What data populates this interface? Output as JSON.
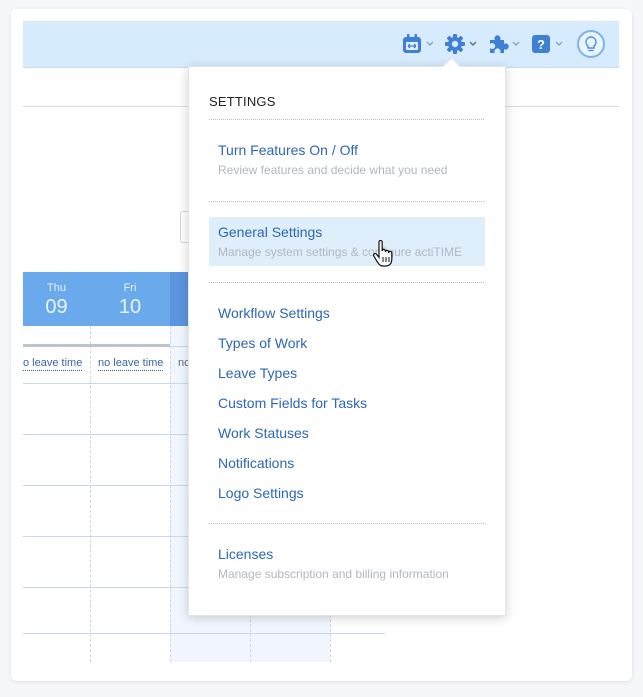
{
  "topbar": {
    "icons": [
      {
        "name": "calendar-icon",
        "has_dropdown": true
      },
      {
        "name": "gear-icon",
        "has_dropdown": true
      },
      {
        "name": "puzzle-icon",
        "has_dropdown": true
      },
      {
        "name": "help-icon",
        "has_dropdown": true
      },
      {
        "name": "lightbulb-icon",
        "has_dropdown": false
      }
    ],
    "help_glyph": "?"
  },
  "calendar": {
    "days": [
      {
        "dow": "Thu",
        "num": "09"
      },
      {
        "dow": "Fri",
        "num": "10"
      }
    ],
    "leave_labels": [
      "o leave time",
      "no leave time",
      "nc"
    ]
  },
  "settings_menu": {
    "title": "SETTINGS",
    "group1": [
      {
        "label": "Turn Features On / Off",
        "sub": "Review features and decide what you need"
      }
    ],
    "group2": [
      {
        "label": "General Settings",
        "sub": "Manage system settings & configure actiTIME",
        "highlighted": true
      }
    ],
    "group3": [
      "Workflow Settings",
      "Types of Work",
      "Leave Types",
      "Custom Fields for Tasks",
      "Work Statuses",
      "Notifications",
      "Logo Settings"
    ],
    "group4": [
      {
        "label": "Licenses",
        "sub": "Manage subscription and billing information"
      }
    ]
  },
  "colors": {
    "accent": "#2d67b7",
    "topbar_bg": "#d6ebfd",
    "day_header": "#6aaaec",
    "highlight": "#dfeefb"
  }
}
